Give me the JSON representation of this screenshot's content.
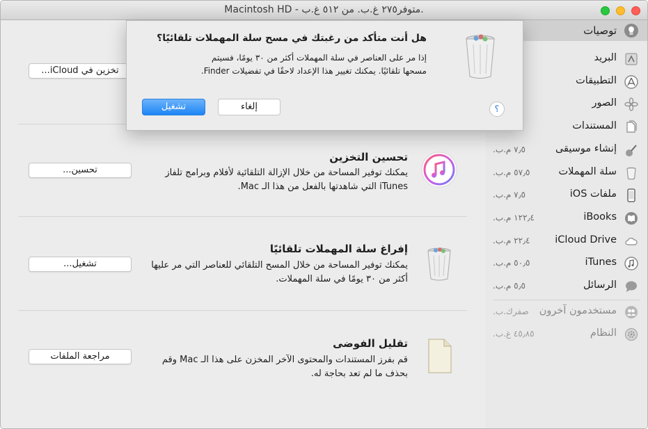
{
  "window": {
    "title": "Macintosh HD - متوفر٢٧٥ غ.ب. من ٥١٢ غ.ب."
  },
  "sidebar": {
    "header": {
      "label": "توصيات",
      "icon": "lightbulb-icon"
    },
    "items": [
      {
        "label": "البريد",
        "size": "",
        "icon": "mail-stamp-icon"
      },
      {
        "label": "التطبيقات",
        "size": "",
        "icon": "app-store-icon"
      },
      {
        "label": "الصور",
        "size": "",
        "icon": "photos-flower-icon"
      },
      {
        "label": "المستندات",
        "size": "",
        "icon": "documents-icon"
      },
      {
        "label": "إنشاء موسيقى",
        "size": "٧٫٥ م.ب.",
        "icon": "guitar-icon"
      },
      {
        "label": "سلة المهملات",
        "size": "٥٧٫٥ م.ب.",
        "icon": "trash-icon"
      },
      {
        "label": "ملفات iOS",
        "size": "٧٫٥ م.ب.",
        "icon": "iphone-icon"
      },
      {
        "label": "iBooks",
        "size": "١٢٢٫٤ م.ب.",
        "icon": "book-icon"
      },
      {
        "label": "iCloud Drive",
        "size": "٢٢٫٤ م.ب.",
        "icon": "cloud-icon"
      },
      {
        "label": "iTunes",
        "size": "٥٠٫٥ م.ب.",
        "icon": "music-note-icon"
      },
      {
        "label": "الرسائل",
        "size": "٥٫٥ م.ب.",
        "icon": "messages-icon"
      }
    ],
    "other": [
      {
        "label": "مستخدمون آخرون",
        "size": "صفرك.ب.",
        "icon": "users-icon"
      },
      {
        "label": "النظام",
        "size": "٤٥٫٨٥ غ.ب.",
        "icon": "gear-icon"
      }
    ]
  },
  "main": {
    "icloud_button": "تخزين في iCloud...",
    "optimize": {
      "title": "تحسين التخزين",
      "desc": "يمكنك توفير المساحة من خلال الإزالة التلقائية لأفلام وبرامج تلفاز iTunes التي شاهدتها بالفعل من هذا الـ Mac.",
      "button": "تحسين..."
    },
    "empty_trash": {
      "title": "إفراغ سلة المهملات تلقائيًا",
      "desc": "يمكنك توفير المساحة من خلال المسح التلقائي للعناصر التي مر عليها أكثر من ٣٠ يومًا في سلة المهملات.",
      "button": "تشغيل..."
    },
    "reduce_clutter": {
      "title": "تقليل الفوضى",
      "desc": "قم بفرز المستندات والمحتوى الآخر المخزن على هذا الـ Mac وقم بحذف ما لم تعد بحاجة له.",
      "button": "مراجعة الملفات"
    }
  },
  "dialog": {
    "title": "هل أنت متأكد من رغبتك في مسح سلة المهملات تلقائيًا؟",
    "message": "إذا مر على العناصر في سلة المهملات أكثر من ٣٠ يومًا، فسيتم مسحها تلقائيًا. يمكنك تغيير هذا الإعداد لاحقًا في تفضيلات Finder.",
    "confirm": "تشغيل",
    "cancel": "إلغاء",
    "help": "؟"
  },
  "colors": {
    "accent": "#1d85f5",
    "itunes_pink": "#f2506e"
  }
}
